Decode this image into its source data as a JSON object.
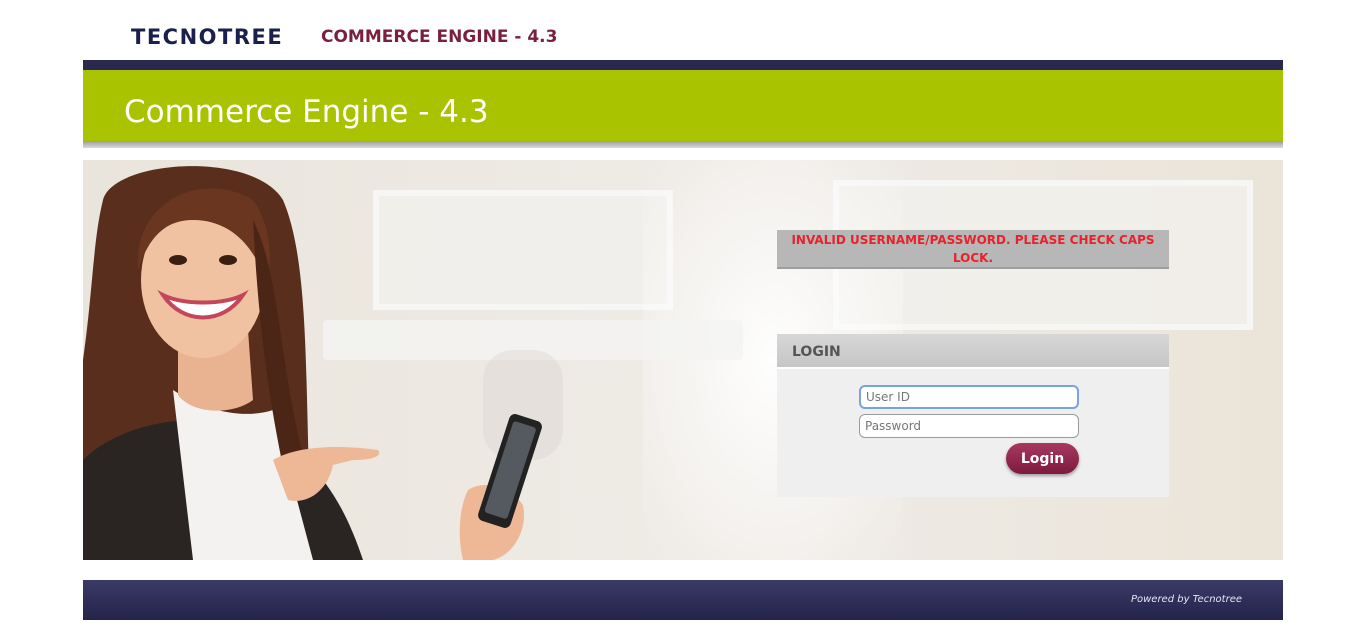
{
  "header": {
    "brand": "TECNOTREE",
    "product": "COMMERCE ENGINE - 4.3"
  },
  "banner": {
    "title": "Commerce Engine - 4.3"
  },
  "error": {
    "message": "INVALID USERNAME/PASSWORD. PLEASE CHECK CAPS LOCK."
  },
  "login": {
    "title": "LOGIN",
    "user_placeholder": "User ID",
    "user_value": "",
    "password_placeholder": "Password",
    "password_value": "",
    "button_label": "Login"
  },
  "footer": {
    "powered_by": "Powered by Tecnotree"
  },
  "colors": {
    "brand_navy": "#1b1f4b",
    "product_maroon": "#7a1f3d",
    "banner_green": "#a9c300",
    "error_red": "#e8212b",
    "button_maroon": "#8a2247",
    "footer_navy": "#2a2850"
  }
}
